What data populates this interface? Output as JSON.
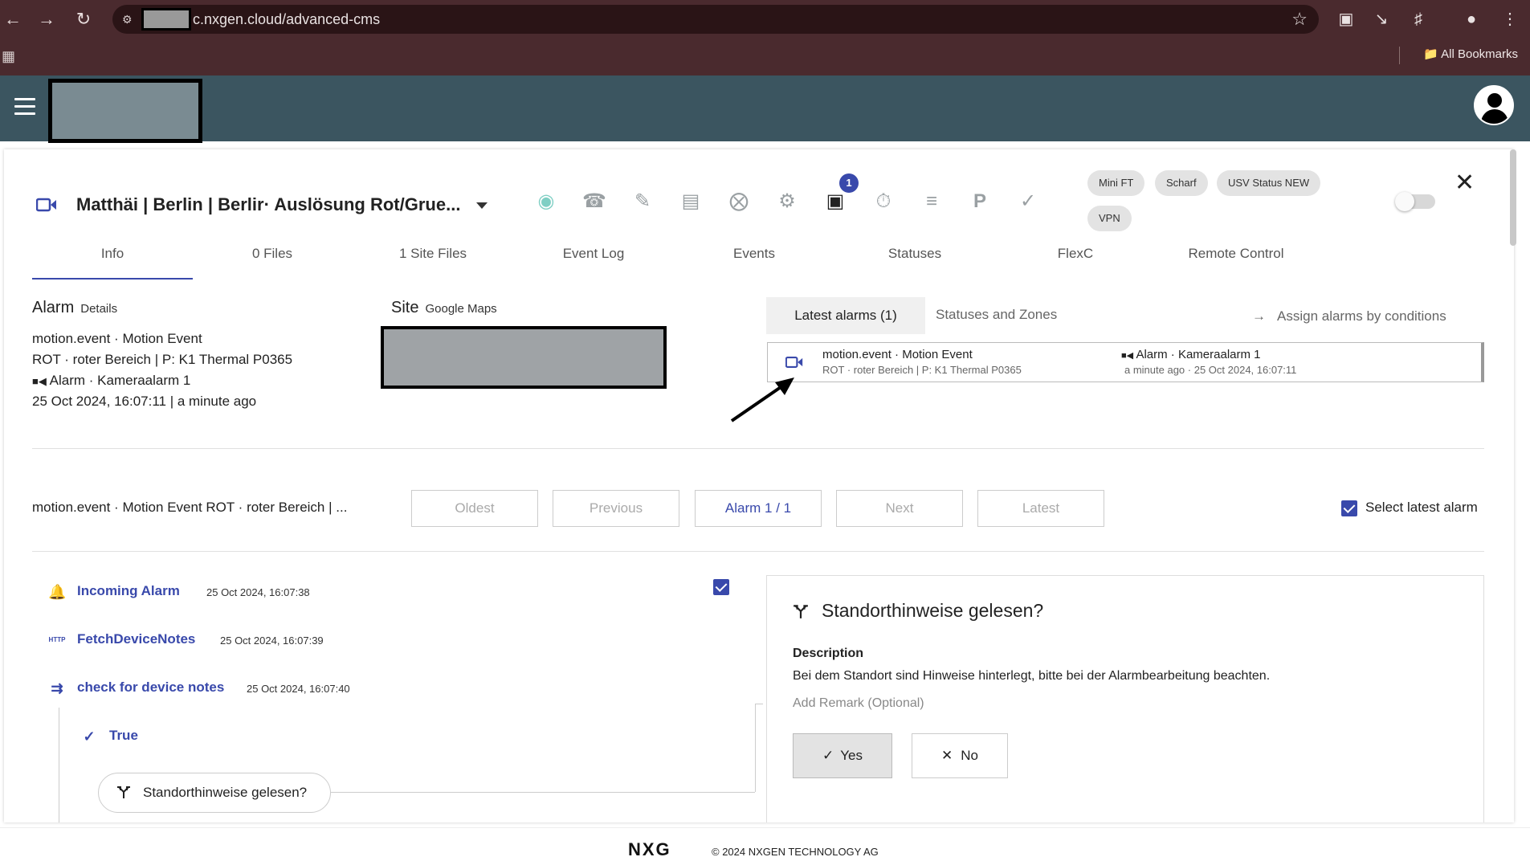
{
  "browser": {
    "url_visible": "c.nxgen.cloud/advanced-cms",
    "bookmarks_label": "All Bookmarks"
  },
  "header": {
    "title": "Matthäi | Berlin | Berlir· Auslösung Rot/Grue...",
    "chips": [
      "Mini FT",
      "Scharf",
      "USV Status NEW",
      "VPN"
    ],
    "notification_count": "1"
  },
  "tabs": [
    "Info",
    "0 Files",
    "1 Site Files",
    "Event Log",
    "Events",
    "Statuses",
    "FlexC",
    "Remote Control"
  ],
  "alarm_section": {
    "title": "Alarm",
    "subtitle": "Details",
    "line1": "motion.event · Motion Event",
    "line2": "ROT · roter Bereich | P: K1 Thermal P0365",
    "line3": "Alarm · Kameraalarm 1",
    "line4": "25 Oct 2024, 16:07:11 | a minute ago"
  },
  "site_section": {
    "title": "Site",
    "subtitle": "Google Maps"
  },
  "alarms_panel": {
    "latest_tab": "Latest alarms (1)",
    "zones_tab": "Statuses and Zones",
    "assign_link": "Assign alarms by conditions",
    "item": {
      "l1": "motion.event · Motion Event",
      "l2": "ROT · roter Bereich | P: K1 Thermal P0365",
      "r1": "Alarm · Kameraalarm 1",
      "r2": "a minute ago · 25 Oct 2024, 16:07:11"
    }
  },
  "navigation": {
    "summary": "motion.event · Motion Event  ROT · roter Bereich | ...",
    "oldest": "Oldest",
    "previous": "Previous",
    "alarm_label": "Alarm",
    "alarm_counter": "1 / 1",
    "next": "Next",
    "latest": "Latest",
    "select_latest": "Select latest alarm"
  },
  "workflow": {
    "steps": [
      {
        "label": "Incoming Alarm",
        "time": "25 Oct 2024, 16:07:38"
      },
      {
        "label": "FetchDeviceNotes",
        "time": "25 Oct 2024, 16:07:39"
      },
      {
        "label": "check for device notes",
        "time": "25 Oct 2024, 16:07:40"
      }
    ],
    "branch": "True",
    "question": "Standorthinweise gelesen?",
    "http_icon_text": "HTTP"
  },
  "question_panel": {
    "title": "Standorthinweise gelesen?",
    "desc_label": "Description",
    "desc": "Bei dem Standort sind Hinweise hinterlegt, bitte bei der Alarmbearbeitung beachten.",
    "remark_placeholder": "Add Remark (Optional)",
    "yes": "Yes",
    "no": "No"
  },
  "footer": {
    "logo": "NXG",
    "copyright": "© 2024 NXGEN TECHNOLOGY AG"
  },
  "colors": {
    "browser_bg": "#4a2a2e",
    "app_header_bg": "#3b5560",
    "accent": "#3949ab"
  }
}
